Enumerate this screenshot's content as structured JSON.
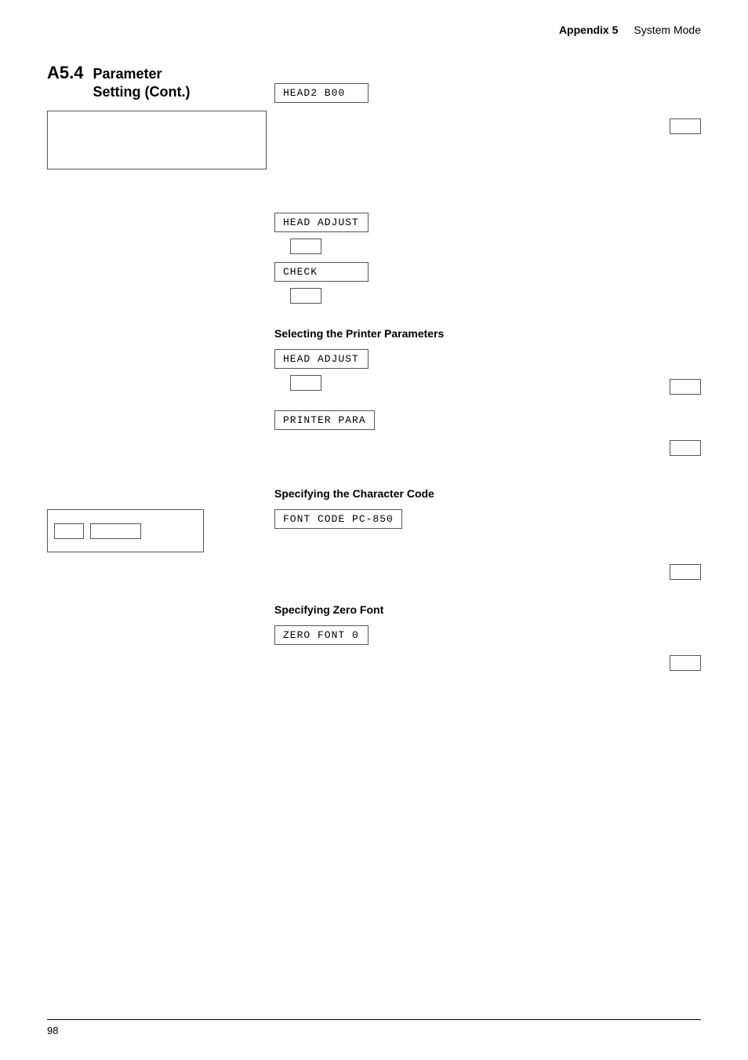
{
  "header": {
    "appendix_label": "Appendix 5",
    "system_mode_label": "System Mode"
  },
  "section": {
    "number": "A5.4",
    "name_line1": "Parameter",
    "name_line2": "Setting (Cont.)"
  },
  "lcd_displays": {
    "head2_b00": "HEAD2    B00",
    "head_adjust_1": "HEAD ADJUST",
    "check": "CHECK",
    "head_adjust_2": "HEAD ADJUST",
    "printer_para": "PRINTER PARA",
    "font_code": "FONT CODE PC-850",
    "zero_font": "ZERO FONT    0"
  },
  "section_titles": {
    "selecting_printer": "Selecting the Printer Parameters",
    "specifying_char_code": "Specifying the Character Code",
    "specifying_zero_font": "Specifying Zero Font"
  },
  "footer": {
    "page_number": "98"
  }
}
